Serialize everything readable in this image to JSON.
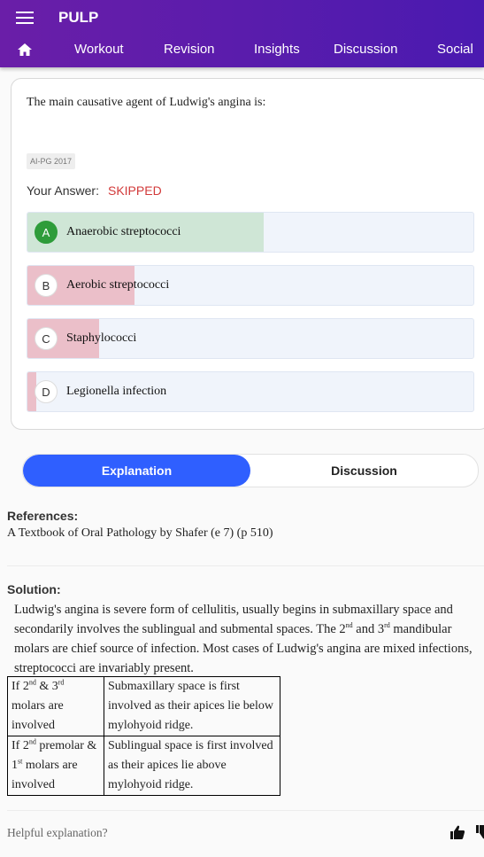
{
  "appbar": {
    "title": "PULP",
    "tabs": [
      "Workout",
      "Revision",
      "Insights",
      "Discussion",
      "Social"
    ]
  },
  "question": {
    "text": "The main causative agent of Ludwig's angina is:",
    "tag": "AI-PG 2017",
    "answer_label": "Your Answer:",
    "answer_value": "SKIPPED",
    "options": [
      {
        "letter": "A",
        "text": "Anaerobic streptococci",
        "percent": 53,
        "correct": true
      },
      {
        "letter": "B",
        "text": "Aerobic streptococci",
        "percent": 24,
        "correct": false
      },
      {
        "letter": "C",
        "text": "Staphylococci",
        "percent": 16,
        "correct": false
      },
      {
        "letter": "D",
        "text": "Legionella infection",
        "percent": 2,
        "correct": false
      }
    ]
  },
  "tabs": {
    "explanation": "Explanation",
    "discussion": "Discussion"
  },
  "references": {
    "heading": "References:",
    "text": "A Textbook of Oral Pathology by Shafer (e 7) (p 510)"
  },
  "solution": {
    "heading": "Solution:",
    "para_1": "Ludwig's angina is severe form of cellulitis, usually begins in submaxillary space and secondarily involves the sublingual and submental spaces. The 2",
    "para_sup_1": "nd",
    "para_2": " and 3",
    "para_sup_2": "rd",
    "para_3": " mandibular molars are chief source of infection. Most cases of Ludwig's angina are mixed infections, streptococci are invariably present.",
    "table": {
      "row1_c1_a": "If 2",
      "row1_c1_sup1": "nd",
      "row1_c1_b": " & 3",
      "row1_c1_sup2": "rd",
      "row1_c1_c": " molars are involved",
      "row1_c2": "Submaxillary space is first involved as their apices lie below mylohyoid ridge.",
      "row2_c1_a": "If 2",
      "row2_c1_sup1": "nd",
      "row2_c1_b": " premolar & 1",
      "row2_c1_sup2": "st",
      "row2_c1_c": " molars are involved",
      "row2_c2": "Sublingual space is first involved as their apices lie above mylohyoid ridge."
    }
  },
  "feedback": {
    "prompt": "Helpful explanation?"
  },
  "colors": {
    "appbar": "#5a1cab",
    "correct_fill": "#cfe6d6",
    "wrong_fill": "#ebbfc9",
    "accent": "#2f5fff",
    "skipped": "#d23a3a"
  },
  "icons": [
    "menu-icon",
    "home-icon",
    "thumbs-up-icon",
    "thumbs-down-icon"
  ]
}
